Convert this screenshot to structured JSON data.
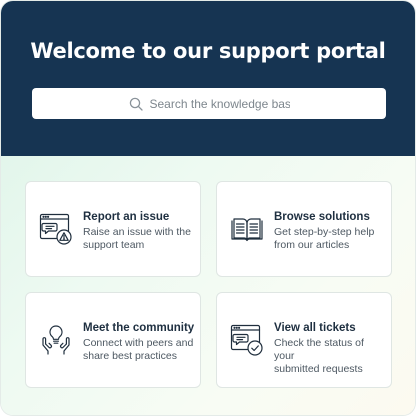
{
  "header": {
    "title": "Welcome to our support portal",
    "background_color": "#163452"
  },
  "search": {
    "placeholder": "Search the knowledge base",
    "icon": "search-icon"
  },
  "cards": [
    {
      "id": "report-issue",
      "icon": "chat-warning-icon",
      "title": "Report an issue",
      "description_line1": "Raise an issue with the",
      "description_line2": "support team"
    },
    {
      "id": "browse-solutions",
      "icon": "open-book-icon",
      "title": "Browse solutions",
      "description_line1": "Get step-by-step help",
      "description_line2": "from our articles"
    },
    {
      "id": "community",
      "icon": "lightbulb-hands-icon",
      "title": "Meet the community",
      "description_line1": "Connect with peers and",
      "description_line2": "share best practices"
    },
    {
      "id": "view-tickets",
      "icon": "chat-check-icon",
      "title": "View all tickets",
      "description_line1": "Check the status of your",
      "description_line2": "submitted requests"
    }
  ]
}
